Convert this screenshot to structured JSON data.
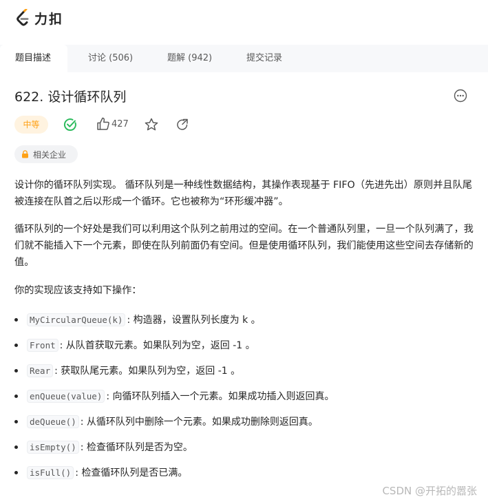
{
  "brand": {
    "name": "力扣"
  },
  "tabs": [
    {
      "label": "题目描述",
      "active": true
    },
    {
      "label": "讨论 (506)",
      "active": false
    },
    {
      "label": "题解 (942)",
      "active": false
    },
    {
      "label": "提交记录",
      "active": false
    }
  ],
  "problem": {
    "title": "622. 设计循环队列",
    "difficulty": "中等",
    "likes": "427",
    "company_tag": "相关企业"
  },
  "description": {
    "p1": "设计你的循环队列实现。 循环队列是一种线性数据结构，其操作表现基于 FIFO（先进先出）原则并且队尾被连接在队首之后以形成一个循环。它也被称为“环形缓冲器”。",
    "p2": "循环队列的一个好处是我们可以利用这个队列之前用过的空间。在一个普通队列里，一旦一个队列满了，我们就不能插入下一个元素，即使在队列前面仍有空间。但是使用循环队列，我们能使用这些空间去存储新的值。",
    "p3": "你的实现应该支持如下操作："
  },
  "operations": [
    {
      "code": "MyCircularQueue(k)",
      "desc": ": 构造器，设置队列长度为 k 。"
    },
    {
      "code": "Front",
      "desc": ": 从队首获取元素。如果队列为空，返回 -1 。"
    },
    {
      "code": "Rear",
      "desc": ": 获取队尾元素。如果队列为空，返回 -1 。"
    },
    {
      "code": "enQueue(value)",
      "desc": ": 向循环队列插入一个元素。如果成功插入则返回真。"
    },
    {
      "code": "deQueue()",
      "desc": ": 从循环队列中删除一个元素。如果成功删除则返回真。"
    },
    {
      "code": "isEmpty()",
      "desc": ": 检查循环队列是否为空。"
    },
    {
      "code": "isFull()",
      "desc": ": 检查循环队列是否已满。"
    }
  ],
  "watermark": "CSDN @开拓的嚣张",
  "colors": {
    "difficulty_text": "#ffa116",
    "difficulty_bg": "#fff3e0",
    "solved": "#2cbb5d",
    "accent_orange": "#ffa116"
  },
  "icons": [
    "leetcode-logo",
    "more-icon",
    "solved-check-icon",
    "thumbs-up-icon",
    "star-icon",
    "share-icon",
    "lock-icon"
  ]
}
